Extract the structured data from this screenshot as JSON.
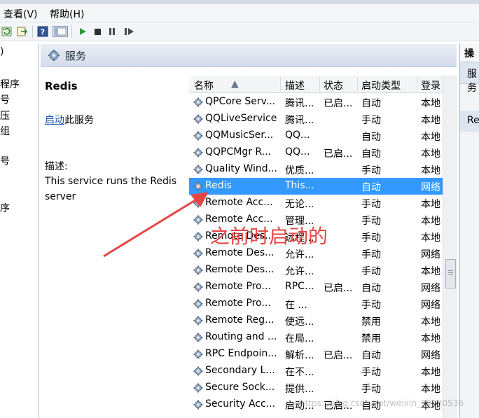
{
  "menu": {
    "view": "查看(V)",
    "help": "帮助(H)"
  },
  "left_stub": [
    ")",
    "程序",
    "号",
    "压",
    "组",
    "号",
    "序"
  ],
  "header": {
    "title": "服务"
  },
  "description": {
    "service_name": "Redis",
    "start_link": "启动",
    "start_suffix": "此服务",
    "desc_label": "描述:",
    "desc_text": "This service runs the Redis server"
  },
  "columns": {
    "name": "名称",
    "description": "描述",
    "status": "状态",
    "startup": "启动类型",
    "logon": "登录"
  },
  "rows": [
    {
      "name": "QPCore Serv...",
      "desc": "腾讯...",
      "status": "已启...",
      "startup": "自动",
      "logon": "本地"
    },
    {
      "name": "QQLiveService",
      "desc": "腾讯...",
      "status": "",
      "startup": "手动",
      "logon": "本地"
    },
    {
      "name": "QQMusicSer...",
      "desc": "QQ...",
      "status": "",
      "startup": "自动",
      "logon": "本地"
    },
    {
      "name": "QQPCMgr R...",
      "desc": "QQ...",
      "status": "已启...",
      "startup": "自动",
      "logon": "本地"
    },
    {
      "name": "Quality Wind...",
      "desc": "优质...",
      "status": "",
      "startup": "手动",
      "logon": "本地"
    },
    {
      "name": "Redis",
      "desc": "This...",
      "status": "",
      "startup": "自动",
      "logon": "网络"
    },
    {
      "name": "Remote Acc...",
      "desc": "无论...",
      "status": "",
      "startup": "手动",
      "logon": "本地"
    },
    {
      "name": "Remote Acc...",
      "desc": "管理...",
      "status": "",
      "startup": "手动",
      "logon": "本地"
    },
    {
      "name": "Remote Des...",
      "desc": "远程...",
      "status": "",
      "startup": "手动",
      "logon": "本地"
    },
    {
      "name": "Remote Des...",
      "desc": "允许...",
      "status": "",
      "startup": "手动",
      "logon": "网络"
    },
    {
      "name": "Remote Des...",
      "desc": "允许...",
      "status": "",
      "startup": "手动",
      "logon": "本地"
    },
    {
      "name": "Remote Pro...",
      "desc": "RPC...",
      "status": "已启...",
      "startup": "自动",
      "logon": "网络"
    },
    {
      "name": "Remote Pro...",
      "desc": "在 ...",
      "status": "",
      "startup": "手动",
      "logon": "网络"
    },
    {
      "name": "Remote Reg...",
      "desc": "使远...",
      "status": "",
      "startup": "禁用",
      "logon": "本地"
    },
    {
      "name": "Routing and ...",
      "desc": "在局...",
      "status": "",
      "startup": "禁用",
      "logon": "本地"
    },
    {
      "name": "RPC Endpoin...",
      "desc": "解析...",
      "status": "已启...",
      "startup": "自动",
      "logon": "网络"
    },
    {
      "name": "Secondary L...",
      "desc": "在不...",
      "status": "",
      "startup": "手动",
      "logon": "本地"
    },
    {
      "name": "Secure Sock...",
      "desc": "提供...",
      "status": "",
      "startup": "手动",
      "logon": "本地"
    },
    {
      "name": "Security Acc...",
      "desc": "启动...",
      "status": "已启...",
      "startup": "自动",
      "logon": "本地"
    }
  ],
  "selected_index": 5,
  "right_pane": {
    "title": "操作",
    "item1": "服务",
    "item2": "Re"
  },
  "annotation": "之前时启动的",
  "watermark": "https://blog.csdn.net/weixin_38230536",
  "colors": {
    "selection": "#3399ff",
    "annotation": "#e64545",
    "link": "#1a56b0"
  }
}
